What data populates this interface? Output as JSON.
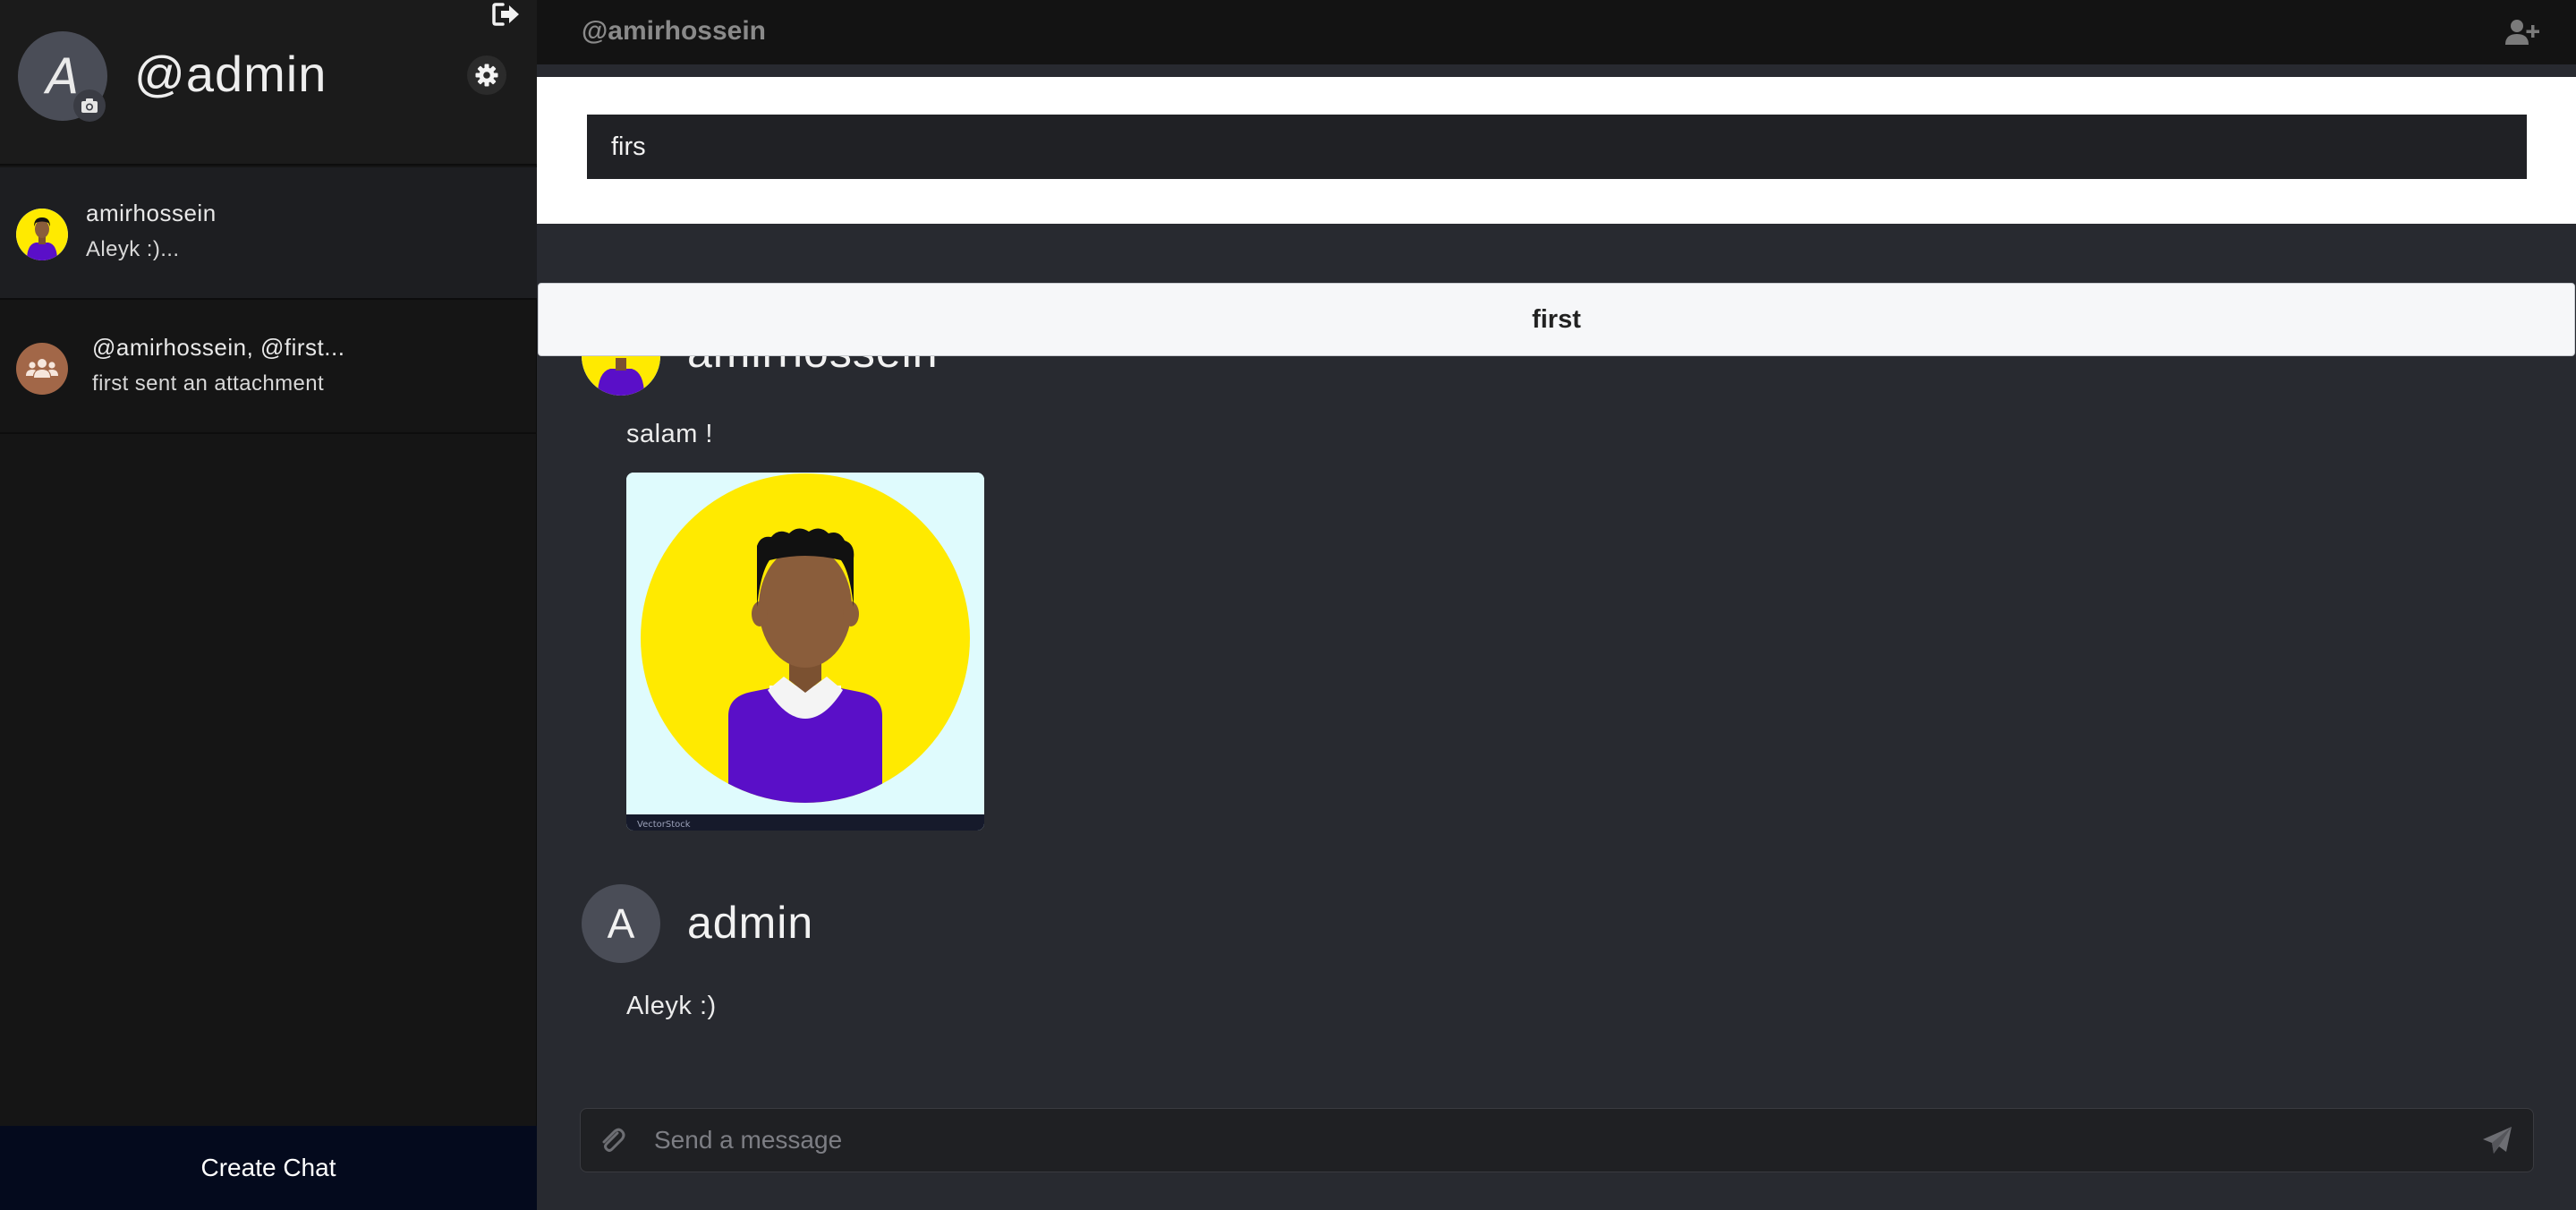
{
  "profile": {
    "avatar_letter": "A",
    "username": "@admin"
  },
  "chats": [
    {
      "title": "amirhossein",
      "preview": "Aleyk :)..."
    },
    {
      "title": "@amirhossein, @first...",
      "preview": "first sent an attachment"
    }
  ],
  "sidebar": {
    "create_chat_label": "Create Chat"
  },
  "header": {
    "title": "@amirhossein"
  },
  "search": {
    "value": "firs"
  },
  "suggestion": {
    "label": "first"
  },
  "messages": [
    {
      "author": "amirhossein",
      "text": "salam !",
      "has_attachment": true
    },
    {
      "author": "admin",
      "avatar_letter": "A",
      "text": "Aleyk :)"
    }
  ],
  "composer": {
    "placeholder": "Send a message"
  },
  "icons": {
    "logout": "sign-out-icon",
    "settings": "gear-icon",
    "camera": "camera-icon",
    "add_user": "user-plus-icon",
    "attach": "paperclip-icon",
    "send": "paper-plane-icon",
    "group": "users-icon"
  },
  "colors": {
    "sidebar_bg": "#151515",
    "main_bg": "#282a30",
    "create_chat_bg": "#040a1d",
    "avatar_yellow": "#ffea00",
    "shirt_purple": "#5a0fc8"
  }
}
